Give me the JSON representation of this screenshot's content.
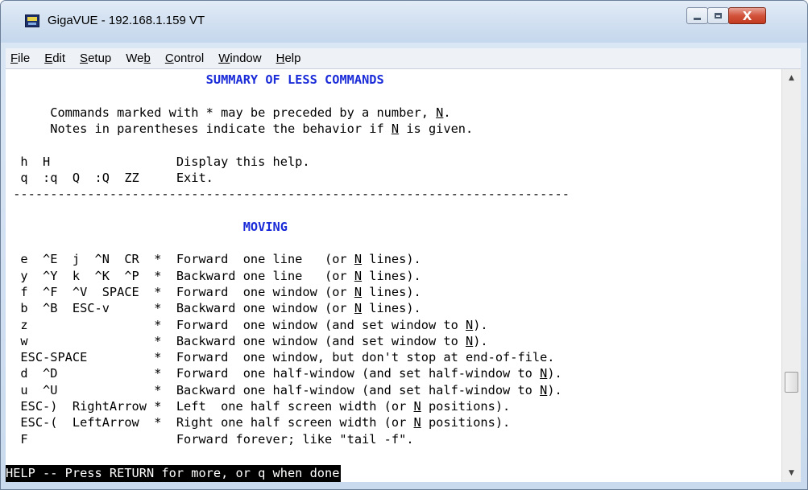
{
  "window": {
    "title": "GigaVUE - 192.168.1.159 VT",
    "controls": {
      "minimize": "",
      "maximize": "",
      "close": "X"
    }
  },
  "menu": [
    {
      "key": "F",
      "rest": "ile"
    },
    {
      "key": "E",
      "rest": "dit"
    },
    {
      "key": "S",
      "rest": "etup"
    },
    {
      "key": "Web",
      "rest": "",
      "underline_last": true
    },
    {
      "key": "C",
      "rest": "ontrol"
    },
    {
      "key": "W",
      "rest": "indow"
    },
    {
      "key": "H",
      "rest": "elp"
    }
  ],
  "terminal": {
    "lines": [
      {
        "parts": [
          {
            "t": "                           "
          },
          {
            "t": "SUMMARY OF LESS COMMANDS",
            "heading": true
          }
        ]
      },
      {
        "parts": []
      },
      {
        "parts": [
          {
            "t": "      Commands marked with * may be preceded by a number, "
          },
          {
            "t": "N",
            "u": true
          },
          {
            "t": "."
          }
        ]
      },
      {
        "parts": [
          {
            "t": "      Notes in parentheses indicate the behavior if "
          },
          {
            "t": "N",
            "u": true
          },
          {
            "t": " is given."
          }
        ]
      },
      {
        "parts": []
      },
      {
        "parts": [
          {
            "t": "  h  H                 Display this help."
          }
        ]
      },
      {
        "parts": [
          {
            "t": "  q  :q  Q  :Q  ZZ     Exit."
          }
        ]
      },
      {
        "parts": [
          {
            "t": " ---------------------------------------------------------------------------"
          }
        ]
      },
      {
        "parts": []
      },
      {
        "parts": [
          {
            "t": "                                "
          },
          {
            "t": "MOVING",
            "heading": true
          }
        ]
      },
      {
        "parts": []
      },
      {
        "parts": [
          {
            "t": "  e  ^E  j  ^N  CR  *  Forward  one line   (or "
          },
          {
            "t": "N",
            "u": true
          },
          {
            "t": " lines)."
          }
        ]
      },
      {
        "parts": [
          {
            "t": "  y  ^Y  k  ^K  ^P  *  Backward one line   (or "
          },
          {
            "t": "N",
            "u": true
          },
          {
            "t": " lines)."
          }
        ]
      },
      {
        "parts": [
          {
            "t": "  f  ^F  ^V  SPACE  *  Forward  one window (or "
          },
          {
            "t": "N",
            "u": true
          },
          {
            "t": " lines)."
          }
        ]
      },
      {
        "parts": [
          {
            "t": "  b  ^B  ESC-v      *  Backward one window (or "
          },
          {
            "t": "N",
            "u": true
          },
          {
            "t": " lines)."
          }
        ]
      },
      {
        "parts": [
          {
            "t": "  z                 *  Forward  one window (and set window to "
          },
          {
            "t": "N",
            "u": true
          },
          {
            "t": ")."
          }
        ]
      },
      {
        "parts": [
          {
            "t": "  w                 *  Backward one window (and set window to "
          },
          {
            "t": "N",
            "u": true
          },
          {
            "t": ")."
          }
        ]
      },
      {
        "parts": [
          {
            "t": "  ESC-SPACE         *  Forward  one window, but don't stop at end-of-file."
          }
        ]
      },
      {
        "parts": [
          {
            "t": "  d  ^D             *  Forward  one half-window (and set half-window to "
          },
          {
            "t": "N",
            "u": true
          },
          {
            "t": ")."
          }
        ]
      },
      {
        "parts": [
          {
            "t": "  u  ^U             *  Backward one half-window (and set half-window to "
          },
          {
            "t": "N",
            "u": true
          },
          {
            "t": ")."
          }
        ]
      },
      {
        "parts": [
          {
            "t": "  ESC-)  RightArrow *  Left  one half screen width (or "
          },
          {
            "t": "N",
            "u": true
          },
          {
            "t": " positions)."
          }
        ]
      },
      {
        "parts": [
          {
            "t": "  ESC-(  LeftArrow  *  Right one half screen width (or "
          },
          {
            "t": "N",
            "u": true
          },
          {
            "t": " positions)."
          }
        ]
      },
      {
        "parts": [
          {
            "t": "  F                    Forward forever; like \"tail -f\"."
          }
        ]
      }
    ],
    "status": "HELP -- Press RETURN for more, or q when done"
  },
  "scrollbar": {
    "up_icon": "scroll-up-arrow-icon",
    "down_icon": "scroll-down-arrow-icon",
    "position": 0.8
  }
}
